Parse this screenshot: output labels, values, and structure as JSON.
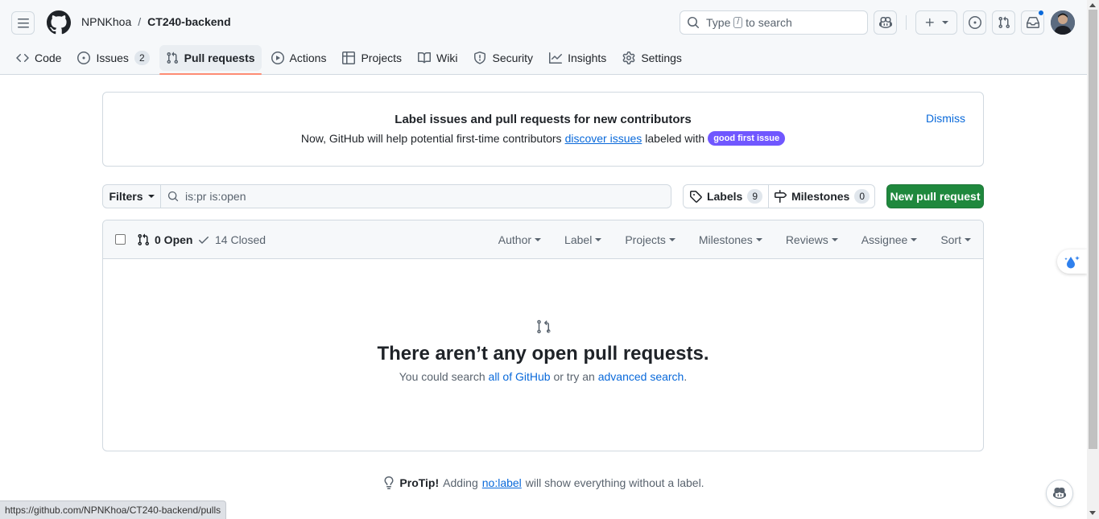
{
  "header": {
    "owner": "NPNKhoa",
    "separator": "/",
    "repo": "CT240-backend",
    "search": {
      "prefix": "Type",
      "key": "/",
      "suffix": "to search"
    }
  },
  "tabs": [
    {
      "label": "Code",
      "icon": "code-icon"
    },
    {
      "label": "Issues",
      "icon": "issue-opened-icon",
      "count": "2"
    },
    {
      "label": "Pull requests",
      "icon": "git-pull-request-icon",
      "active": true
    },
    {
      "label": "Actions",
      "icon": "play-icon"
    },
    {
      "label": "Projects",
      "icon": "table-icon"
    },
    {
      "label": "Wiki",
      "icon": "book-icon"
    },
    {
      "label": "Security",
      "icon": "shield-icon"
    },
    {
      "label": "Insights",
      "icon": "graph-icon"
    },
    {
      "label": "Settings",
      "icon": "gear-icon"
    }
  ],
  "banner": {
    "title": "Label issues and pull requests for new contributors",
    "text_before": "Now, GitHub will help potential first-time contributors",
    "link": "discover issues",
    "text_after": "labeled with",
    "badge": "good first issue",
    "dismiss": "Dismiss"
  },
  "filterbar": {
    "filters_label": "Filters",
    "query": "is:pr is:open",
    "labels_label": "Labels",
    "labels_count": "9",
    "milestones_label": "Milestones",
    "milestones_count": "0",
    "new_pr_label": "New pull request"
  },
  "list": {
    "open_label": "0 Open",
    "closed_label": "14 Closed",
    "menus": [
      "Author",
      "Label",
      "Projects",
      "Milestones",
      "Reviews",
      "Assignee",
      "Sort"
    ],
    "blank_title": "There aren’t any open pull requests.",
    "blank_before": "You could search",
    "blank_link1": "all of GitHub",
    "blank_middle": "or try an",
    "blank_link2": "advanced search",
    "blank_end": "."
  },
  "protip": {
    "bold": "ProTip!",
    "before": "Adding",
    "link": "no:label",
    "after": "will show everything without a label."
  },
  "statusbar": {
    "url": "https://github.com/NPNKhoa/CT240-backend/pulls"
  },
  "colors": {
    "accent": "#0969da",
    "primary_button": "#1f883d",
    "badge": "#7057ff",
    "active_tab_underline": "#fd8c73"
  }
}
